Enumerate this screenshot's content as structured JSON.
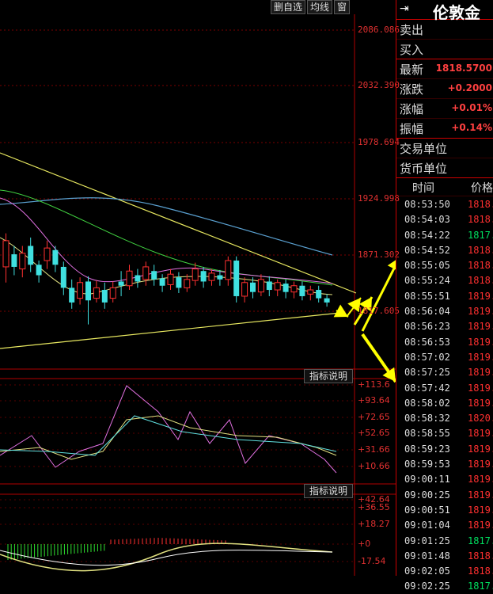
{
  "toolbar": {
    "b1": "删自选",
    "b2": "均线",
    "b3": "窗",
    "expand": "◂▸"
  },
  "price_axis": [
    "2086.086",
    "2032.390",
    "1978.694",
    "1924.998",
    "1871.302",
    "1817.605"
  ],
  "ind1": {
    "button": "指标说明",
    "ticks": [
      "+113.6",
      "+93.64",
      "+72.65",
      "+52.65",
      "+31.66",
      "+10.66"
    ]
  },
  "ind2": {
    "button": "指标说明",
    "ticks": [
      "+42.64",
      "+36.55",
      "+18.27",
      "+0",
      "-17.54"
    ]
  },
  "panel": {
    "title": "伦敦金",
    "rows": [
      {
        "label": "卖出",
        "value": ""
      },
      {
        "label": "买入",
        "value": ""
      },
      {
        "label": "最新",
        "value": "1818.5700"
      },
      {
        "label": "涨跌",
        "value": "+0.2000"
      },
      {
        "label": "涨幅",
        "value": "+0.01%"
      },
      {
        "label": "振幅",
        "value": "+0.14%"
      },
      {
        "label": "交易单位",
        "value": ""
      },
      {
        "label": "货币单位",
        "value": ""
      }
    ],
    "time_header": "时间",
    "price_header": "价格",
    "ticks": [
      {
        "time": "08:53:50",
        "price": "1818.",
        "dir": "up"
      },
      {
        "time": "08:54:03",
        "price": "1818.",
        "dir": "up"
      },
      {
        "time": "08:54:22",
        "price": "1817.",
        "dir": "dn"
      },
      {
        "time": "08:54:52",
        "price": "1818.",
        "dir": "up"
      },
      {
        "time": "08:55:05",
        "price": "1818.",
        "dir": "up"
      },
      {
        "time": "08:55:24",
        "price": "1818.",
        "dir": "up"
      },
      {
        "time": "08:55:51",
        "price": "1819.",
        "dir": "up"
      },
      {
        "time": "08:56:04",
        "price": "1819.",
        "dir": "up"
      },
      {
        "time": "08:56:23",
        "price": "1819.",
        "dir": "up"
      },
      {
        "time": "08:56:53",
        "price": "1819.",
        "dir": "up"
      },
      {
        "time": "08:57:02",
        "price": "1819.",
        "dir": "up"
      },
      {
        "time": "08:57:25",
        "price": "1819.",
        "dir": "up"
      },
      {
        "time": "08:57:42",
        "price": "1819.",
        "dir": "up"
      },
      {
        "time": "08:58:02",
        "price": "1819.",
        "dir": "up"
      },
      {
        "time": "08:58:32",
        "price": "1820.",
        "dir": "up"
      },
      {
        "time": "08:58:55",
        "price": "1819.",
        "dir": "up"
      },
      {
        "time": "08:59:23",
        "price": "1819.",
        "dir": "up"
      },
      {
        "time": "08:59:53",
        "price": "1819.",
        "dir": "up"
      },
      {
        "time": "09:00:11",
        "price": "1819.",
        "dir": "up"
      },
      {
        "time": "09:00:25",
        "price": "1819.",
        "dir": "up"
      },
      {
        "time": "09:00:51",
        "price": "1819.",
        "dir": "up"
      },
      {
        "time": "09:01:04",
        "price": "1819.",
        "dir": "up"
      },
      {
        "time": "09:01:25",
        "price": "1817.",
        "dir": "dn"
      },
      {
        "time": "09:01:48",
        "price": "1818.",
        "dir": "up"
      },
      {
        "time": "09:02:05",
        "price": "1818.",
        "dir": "up"
      },
      {
        "time": "09:02:25",
        "price": "1817.",
        "dir": "dn"
      }
    ]
  },
  "chart_data": {
    "type": "candlestick",
    "yaxis_ticks": [
      2086.086,
      2032.39,
      1978.694,
      1924.998,
      1871.302,
      1817.605
    ],
    "ylim": [
      1795,
      2100
    ],
    "candles": [
      [
        1860,
        1885,
        1845,
        1892
      ],
      [
        1872,
        1860,
        1852,
        1880
      ],
      [
        1858,
        1873,
        1850,
        1880
      ],
      [
        1880,
        1862,
        1855,
        1888
      ],
      [
        1862,
        1852,
        1845,
        1866
      ],
      [
        1866,
        1878,
        1858,
        1885
      ],
      [
        1876,
        1862,
        1855,
        1880
      ],
      [
        1860,
        1840,
        1833,
        1865
      ],
      [
        1840,
        1826,
        1820,
        1848
      ],
      [
        1830,
        1845,
        1824,
        1850
      ],
      [
        1846,
        1828,
        1805,
        1851
      ],
      [
        1830,
        1840,
        1826,
        1847
      ],
      [
        1838,
        1826,
        1820,
        1845
      ],
      [
        1830,
        1840,
        1826,
        1846
      ],
      [
        1846,
        1842,
        1832,
        1856
      ],
      [
        1842,
        1856,
        1838,
        1862
      ],
      [
        1852,
        1846,
        1840,
        1858
      ],
      [
        1848,
        1860,
        1842,
        1865
      ],
      [
        1856,
        1848,
        1842,
        1862
      ],
      [
        1849,
        1842,
        1836,
        1853
      ],
      [
        1843,
        1853,
        1838,
        1858
      ],
      [
        1850,
        1840,
        1835,
        1855
      ],
      [
        1840,
        1848,
        1836,
        1853
      ],
      [
        1847,
        1858,
        1842,
        1864
      ],
      [
        1856,
        1846,
        1840,
        1860
      ],
      [
        1847,
        1854,
        1842,
        1858
      ],
      [
        1852,
        1848,
        1842,
        1857
      ],
      [
        1848,
        1866,
        1842,
        1870
      ],
      [
        1866,
        1832,
        1826,
        1870
      ],
      [
        1832,
        1845,
        1826,
        1850
      ],
      [
        1845,
        1836,
        1830,
        1850
      ],
      [
        1836,
        1848,
        1832,
        1853
      ],
      [
        1846,
        1838,
        1832,
        1851
      ],
      [
        1838,
        1845,
        1832,
        1848
      ],
      [
        1844,
        1836,
        1830,
        1848
      ],
      [
        1836,
        1842,
        1830,
        1846
      ],
      [
        1842,
        1832,
        1828,
        1846
      ],
      [
        1834,
        1838,
        1828,
        1842
      ],
      [
        1838,
        1830,
        1826,
        1842
      ],
      [
        1830,
        1826,
        1822,
        1834
      ]
    ]
  }
}
